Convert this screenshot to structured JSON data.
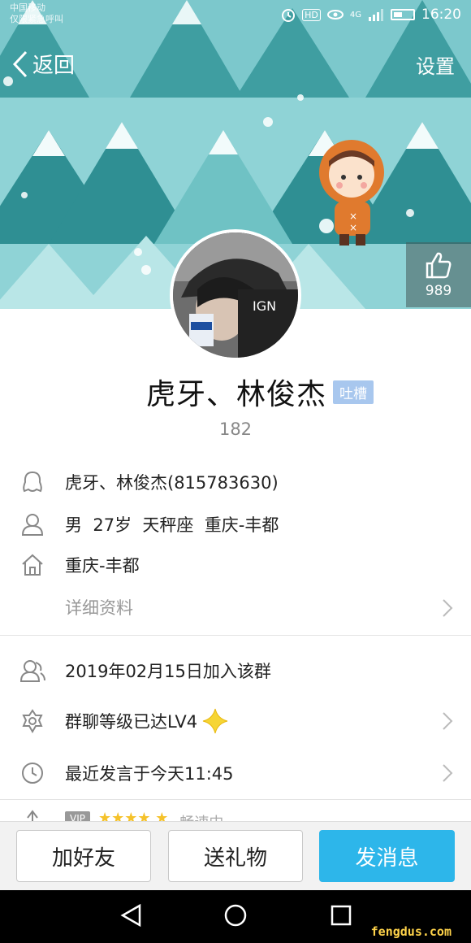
{
  "status_bar": {
    "carrier_line1": "中国移动",
    "carrier_line2": "仅限紧急呼叫",
    "hd": "HD",
    "network": "4G",
    "time": "16:20"
  },
  "nav": {
    "back_label": "返回",
    "settings_label": "设置"
  },
  "likes": {
    "count": "989"
  },
  "profile": {
    "name": "虎牙、林俊杰",
    "tag": "吐槽",
    "popularity": "182"
  },
  "info": {
    "qq": "虎牙、林俊杰(815783630)",
    "basic": "男  27岁  天秤座  重庆-丰都",
    "hometown": "重庆-丰都",
    "detail_link": "详细资料"
  },
  "group": {
    "joined": "2019年02月15日加入该群",
    "level": "群聊等级已达LV4",
    "last_speak": "最近发言于今天11:45",
    "vip_label": "VIP",
    "speed_label": "畅速中"
  },
  "actions": {
    "add_friend": "加好友",
    "send_gift": "送礼物",
    "send_message": "发消息"
  },
  "watermark": "fengdus.com",
  "colors": {
    "banner_bg": "#8fd3d6",
    "tree_dark": "#3f9ea1",
    "tree_light": "#6fc2c4",
    "message_button": "#2db6ea",
    "tag_bg": "#a8c7ee"
  }
}
